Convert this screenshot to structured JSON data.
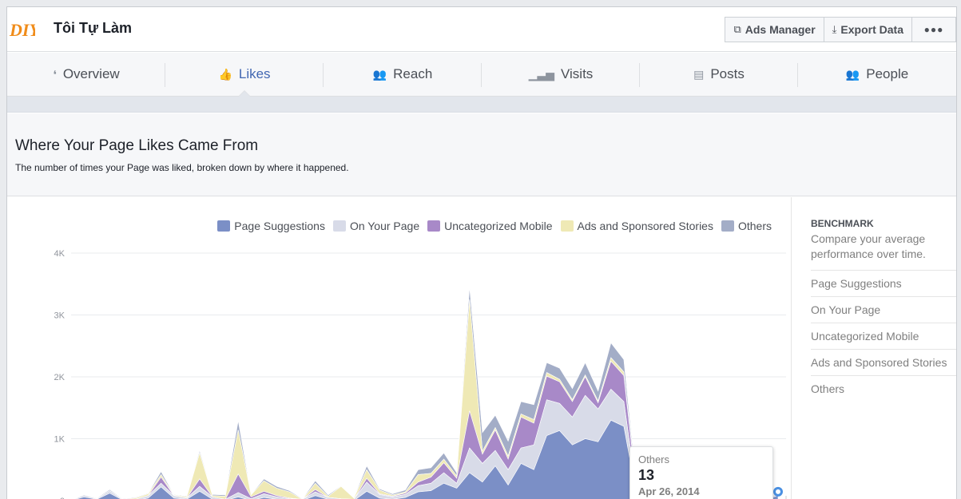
{
  "app": {
    "page_name": "Tôi Tự Làm",
    "logo_text": "DIY"
  },
  "header": {
    "ads_manager_label": "Ads Manager",
    "export_label": "Export Data",
    "more_label": "●●●"
  },
  "tabs": [
    {
      "label": "Overview",
      "icon": "megaphone-icon",
      "glyph": "❛"
    },
    {
      "label": "Likes",
      "icon": "thumbs-up-icon",
      "glyph": "👍"
    },
    {
      "label": "Reach",
      "icon": "people-icon",
      "glyph": "👥"
    },
    {
      "label": "Visits",
      "icon": "bars-icon",
      "glyph": "▁▃▅"
    },
    {
      "label": "Posts",
      "icon": "list-icon",
      "glyph": "▤"
    },
    {
      "label": "People",
      "icon": "group-icon",
      "glyph": "👥"
    }
  ],
  "active_tab": "Likes",
  "section": {
    "title": "Where Your Page Likes Came From",
    "subtitle": "The number of times your Page was liked, broken down by where it happened."
  },
  "chart_data": {
    "type": "area",
    "stacked": true,
    "y_ticks": [
      "0",
      "1K",
      "2K",
      "3K",
      "4K"
    ],
    "ylim": [
      0,
      4000
    ],
    "grid": true,
    "legend_position": "top-right",
    "series": [
      {
        "name": "Page Suggestions",
        "color": "#7b8fc6",
        "values": [
          0,
          60,
          20,
          120,
          10,
          0,
          40,
          220,
          40,
          20,
          150,
          20,
          0,
          60,
          0,
          50,
          20,
          10,
          0,
          80,
          20,
          10,
          0,
          150,
          40,
          20,
          50,
          140,
          160,
          280,
          200,
          450,
          300,
          560,
          250,
          600,
          500,
          1050,
          1130,
          900,
          1000,
          950,
          1300,
          1200,
          80,
          60,
          60,
          50,
          480,
          500,
          400,
          100,
          50,
          30,
          20,
          80
        ]
      },
      {
        "name": "On Your Page",
        "color": "#d8dbe8",
        "values": [
          0,
          30,
          10,
          40,
          10,
          20,
          40,
          60,
          40,
          20,
          80,
          40,
          20,
          70,
          30,
          60,
          40,
          20,
          20,
          60,
          30,
          20,
          20,
          150,
          60,
          40,
          50,
          100,
          120,
          170,
          80,
          400,
          300,
          250,
          250,
          250,
          400,
          580,
          440,
          450,
          700,
          530,
          500,
          400,
          40,
          40,
          30,
          30,
          100,
          150,
          150,
          40,
          30,
          20,
          20,
          30
        ]
      },
      {
        "name": "Uncategorized Mobile",
        "color": "#a889c8",
        "values": [
          0,
          0,
          0,
          0,
          0,
          0,
          0,
          100,
          0,
          0,
          120,
          0,
          0,
          300,
          30,
          40,
          20,
          10,
          0,
          40,
          0,
          0,
          0,
          60,
          10,
          10,
          20,
          60,
          100,
          160,
          80,
          600,
          150,
          330,
          170,
          500,
          350,
          380,
          350,
          250,
          300,
          100,
          450,
          420,
          20,
          20,
          10,
          10,
          80,
          80,
          50,
          20,
          10,
          10,
          10,
          10
        ]
      },
      {
        "name": "Ads and Sponsored Stories",
        "color": "#efe9b5",
        "values": [
          0,
          0,
          0,
          0,
          0,
          20,
          30,
          40,
          10,
          20,
          420,
          20,
          50,
          710,
          30,
          170,
          120,
          100,
          0,
          100,
          20,
          200,
          20,
          140,
          60,
          20,
          20,
          120,
          60,
          60,
          40,
          1800,
          50,
          40,
          50,
          50,
          60,
          60,
          40,
          30,
          30,
          30,
          60,
          60,
          30,
          30,
          20,
          20,
          20,
          20,
          10,
          10,
          10,
          10,
          10,
          10
        ]
      },
      {
        "name": "Others",
        "color": "#a3adc7",
        "values": [
          0,
          10,
          10,
          20,
          10,
          10,
          10,
          50,
          10,
          10,
          40,
          20,
          20,
          150,
          10,
          30,
          30,
          20,
          10,
          40,
          20,
          10,
          10,
          60,
          20,
          20,
          30,
          80,
          90,
          100,
          50,
          200,
          300,
          200,
          240,
          200,
          240,
          160,
          180,
          180,
          200,
          160,
          240,
          200,
          40,
          40,
          20,
          20,
          70,
          50,
          40,
          20,
          20,
          10,
          10,
          13
        ]
      }
    ],
    "legend": [
      "Page Suggestions",
      "On Your Page",
      "Uncategorized Mobile",
      "Ads and Sponsored Stories",
      "Others"
    ]
  },
  "benchmark": {
    "title": "BENCHMARK",
    "subtitle": "Compare your average performance over time.",
    "items": [
      "Page Suggestions",
      "On Your Page",
      "Uncategorized Mobile",
      "Ads and Sponsored Stories",
      "Others"
    ]
  },
  "tooltip": {
    "series": "Others",
    "value": "13",
    "date": "Apr 26, 2014"
  }
}
